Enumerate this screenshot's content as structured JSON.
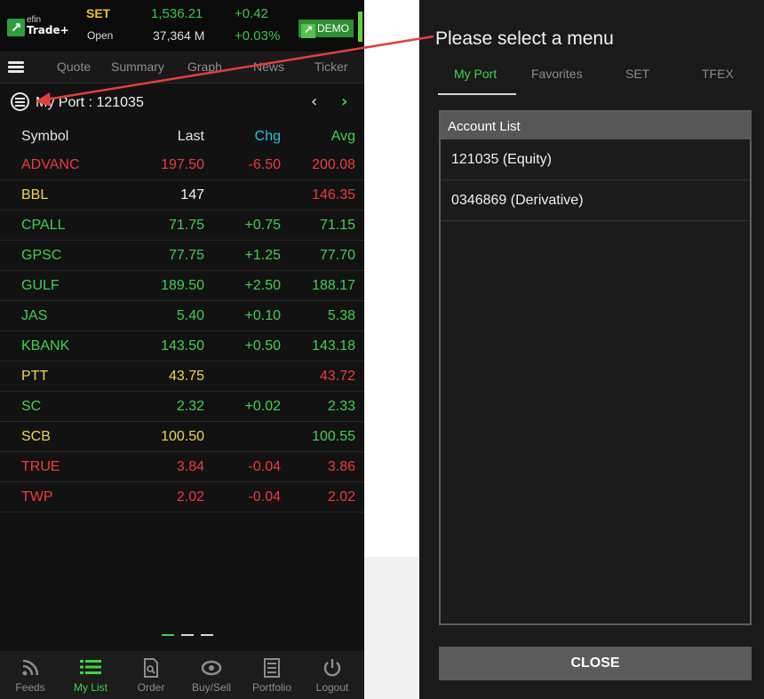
{
  "header": {
    "logo_mark": "↗",
    "logo_small": "efin",
    "logo_main": "Trade+",
    "market": "SET",
    "status": "Open",
    "index_value": "1,536.21",
    "volume": "37,364 M",
    "change": "+0.42",
    "change_pct": "+0.03%",
    "demo_label": "DEMO"
  },
  "tabs": [
    "Quote",
    "Summary",
    "Graph",
    "News",
    "Ticker"
  ],
  "port": {
    "title": "My Port : 121035",
    "prev": "‹",
    "next": "›"
  },
  "columns": {
    "symbol": "Symbol",
    "last": "Last",
    "chg": "Chg",
    "avg": "Avg"
  },
  "stocks": [
    {
      "symbol": "ADVANC",
      "last": "197.50",
      "chg": "-6.50",
      "avg": "200.08"
    },
    {
      "symbol": "BBL",
      "last": "147",
      "chg": "",
      "avg": "146.35"
    },
    {
      "symbol": "CPALL",
      "last": "71.75",
      "chg": "+0.75",
      "avg": "71.15"
    },
    {
      "symbol": "GPSC",
      "last": "77.75",
      "chg": "+1.25",
      "avg": "77.70"
    },
    {
      "symbol": "GULF",
      "last": "189.50",
      "chg": "+2.50",
      "avg": "188.17"
    },
    {
      "symbol": "JAS",
      "last": "5.40",
      "chg": "+0.10",
      "avg": "5.38"
    },
    {
      "symbol": "KBANK",
      "last": "143.50",
      "chg": "+0.50",
      "avg": "143.18"
    },
    {
      "symbol": "PTT",
      "last": "43.75",
      "chg": "",
      "avg": "43.72"
    },
    {
      "symbol": "SC",
      "last": "2.32",
      "chg": "+0.02",
      "avg": "2.33"
    },
    {
      "symbol": "SCB",
      "last": "100.50",
      "chg": "",
      "avg": "100.55"
    },
    {
      "symbol": "TRUE",
      "last": "3.84",
      "chg": "-0.04",
      "avg": "3.86"
    },
    {
      "symbol": "TWP",
      "last": "2.02",
      "chg": "-0.04",
      "avg": "2.02"
    }
  ],
  "bottom_nav": [
    {
      "label": "Feeds",
      "icon": "feeds-icon"
    },
    {
      "label": "My List",
      "icon": "list-icon"
    },
    {
      "label": "Order",
      "icon": "order-icon"
    },
    {
      "label": "Buy/Sell",
      "icon": "buysell-icon"
    },
    {
      "label": "Portfolio",
      "icon": "portfolio-icon"
    },
    {
      "label": "Logout",
      "icon": "power-icon"
    }
  ],
  "menu": {
    "title": "Please select a menu",
    "tabs": [
      "My Port",
      "Favorites",
      "SET",
      "TFEX"
    ],
    "list_header": "Account List",
    "accounts": [
      "121035 (Equity)",
      "0346869 (Derivative)"
    ],
    "close_label": "CLOSE"
  },
  "colors": {
    "up": "#3fd24d",
    "down": "#ef3b3b",
    "unchanged": "#f1d54a",
    "white": "#f2f2f2",
    "chg_header": "#24c6d6",
    "avg_header": "#3fd24d",
    "accent": "#3fd24d",
    "arrow": "#e0403a"
  }
}
